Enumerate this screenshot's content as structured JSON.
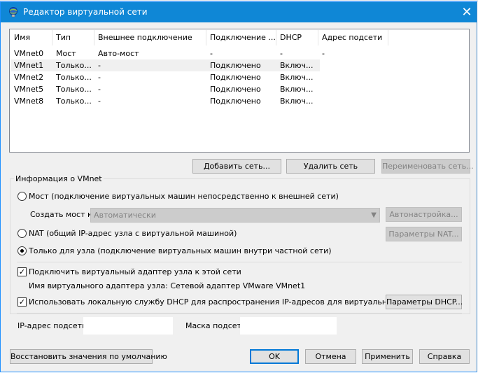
{
  "window": {
    "title": "Редактор виртуальной сети",
    "close_glyph": "✕"
  },
  "table": {
    "headers": [
      "Имя",
      "Тип",
      "Внешнее подключение",
      "Подключение ...",
      "DHCP",
      "Адрес подсети"
    ],
    "rows": [
      [
        "VMnet0",
        "Мост",
        "Авто-мост",
        "-",
        "-",
        "-"
      ],
      [
        "VMnet1",
        "Только...",
        "-",
        "Подключено",
        "Включ...",
        ""
      ],
      [
        "VMnet2",
        "Только...",
        "-",
        "Подключено",
        "Включ...",
        ""
      ],
      [
        "VMnet5",
        "Только...",
        "-",
        "Подключено",
        "Включ...",
        ""
      ],
      [
        "VMnet8",
        "Только...",
        "-",
        "Подключено",
        "Включ...",
        ""
      ]
    ]
  },
  "buttons": {
    "add_network": "Добавить сеть...",
    "remove_network": "Удалить сеть",
    "rename_network": "Переименовать сеть...",
    "auto_settings": "Автонастройка...",
    "nat_settings": "Параметры NAT...",
    "dhcp_settings": "Параметры DHCP...",
    "restore_defaults": "Восстановить значения по умолчанию",
    "ok": "OK",
    "cancel": "Отмена",
    "apply": "Применить",
    "help": "Справка"
  },
  "vmnet_info": {
    "group_title": "Информация о VMnet",
    "bridged_label": "Мост (подключение виртуальных машин непосредственно к внешней сети)",
    "bridge_to_label": "Создать мост к:",
    "bridge_to_value": "Автоматически",
    "nat_label": "NAT (общий IP-адрес узла с виртуальной машиной)",
    "hostonly_label": "Только для узла (подключение виртуальных машин внутри частной сети)",
    "connect_adapter_label": "Подключить виртуальный адаптер узла к этой сети",
    "adapter_name_text": "Имя виртуального адаптера узла: Сетевой адаптер VMware VMnet1",
    "use_dhcp_label": "Использовать локальную службу DHCP для распространения IP-адресов для виртуальных машин",
    "subnet_ip_label": "IP-адрес подсети:",
    "subnet_ip_value": "",
    "subnet_mask_label": "Маска подсети:",
    "subnet_mask_value": ""
  },
  "state": {
    "selected_mode": "hostonly",
    "connect_adapter_checked": true,
    "use_dhcp_checked": true,
    "selected_row": "VMnet1"
  }
}
